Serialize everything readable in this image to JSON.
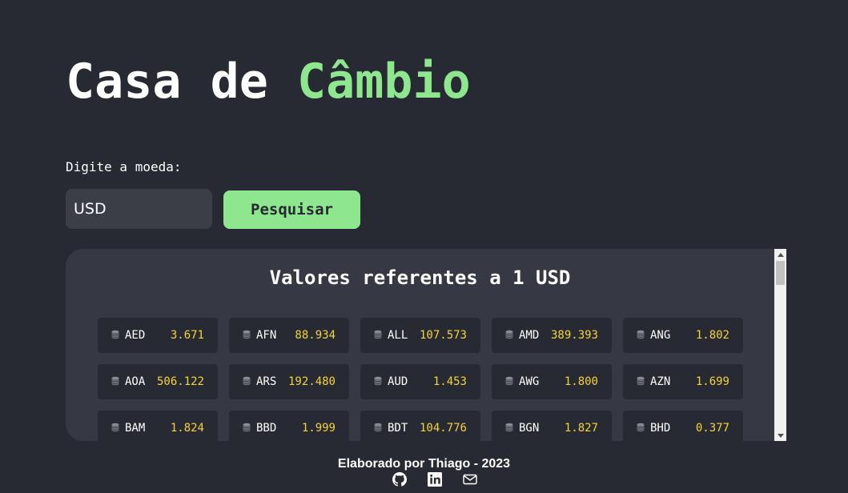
{
  "header": {
    "title_prefix": "Casa de ",
    "title_accent": "Câmbio"
  },
  "search": {
    "label": "Digite a moeda:",
    "value": "USD",
    "button_label": "Pesquisar"
  },
  "results": {
    "title": "Valores referentes a 1 USD",
    "rates": [
      {
        "code": "AED",
        "value": "3.671"
      },
      {
        "code": "AFN",
        "value": "88.934"
      },
      {
        "code": "ALL",
        "value": "107.573"
      },
      {
        "code": "AMD",
        "value": "389.393"
      },
      {
        "code": "ANG",
        "value": "1.802"
      },
      {
        "code": "AOA",
        "value": "506.122"
      },
      {
        "code": "ARS",
        "value": "192.480"
      },
      {
        "code": "AUD",
        "value": "1.453"
      },
      {
        "code": "AWG",
        "value": "1.800"
      },
      {
        "code": "AZN",
        "value": "1.699"
      },
      {
        "code": "BAM",
        "value": "1.824"
      },
      {
        "code": "BBD",
        "value": "1.999"
      },
      {
        "code": "BDT",
        "value": "104.776"
      },
      {
        "code": "BGN",
        "value": "1.827"
      },
      {
        "code": "BHD",
        "value": "0.377"
      }
    ]
  },
  "footer": {
    "text": "Elaborado por Thiago - 2023",
    "icons": [
      "github-icon",
      "linkedin-icon",
      "mail-icon"
    ]
  },
  "colors": {
    "background": "#272a32",
    "accent": "#8ee68f",
    "panel": "#363943",
    "value": "#f5d33b"
  }
}
